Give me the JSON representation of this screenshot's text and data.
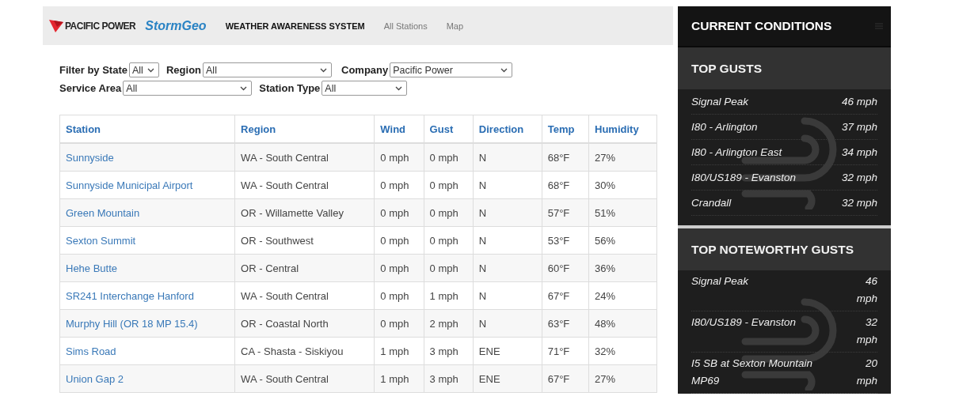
{
  "header": {
    "brand": "PACIFIC POWER",
    "partner": "StormGeo",
    "title": "WEATHER AWARENESS SYSTEM",
    "nav": [
      {
        "label": "All Stations"
      },
      {
        "label": "Map"
      }
    ]
  },
  "filter_rows": [
    [
      {
        "label": "Filter by State",
        "value": "All"
      },
      {
        "label": "Region",
        "value": "All"
      },
      {
        "label": "Company",
        "value": "Pacific Power"
      }
    ],
    [
      {
        "label": "Service Area",
        "value": "All"
      },
      {
        "label": "Station Type",
        "value": "All"
      }
    ]
  ],
  "table": {
    "columns": [
      "Station",
      "Region",
      "Wind",
      "Gust",
      "Direction",
      "Temp",
      "Humidity"
    ],
    "rows": [
      [
        "Sunnyside",
        "WA - South Central",
        "0 mph",
        "0 mph",
        "N",
        "68°F",
        "27%"
      ],
      [
        "Sunnyside Municipal Airport",
        "WA - South Central",
        "0 mph",
        "0 mph",
        "N",
        "68°F",
        "30%"
      ],
      [
        "Green Mountain",
        "OR - Willamette Valley",
        "0 mph",
        "0 mph",
        "N",
        "57°F",
        "51%"
      ],
      [
        "Sexton Summit",
        "OR - Southwest",
        "0 mph",
        "0 mph",
        "N",
        "53°F",
        "56%"
      ],
      [
        "Hehe Butte",
        "OR - Central",
        "0 mph",
        "0 mph",
        "N",
        "60°F",
        "36%"
      ],
      [
        "SR241 Interchange Hanford",
        "WA - South Central",
        "0 mph",
        "1 mph",
        "N",
        "67°F",
        "24%"
      ],
      [
        "Murphy Hill (OR 18 MP 15.4)",
        "OR - Coastal North",
        "0 mph",
        "2 mph",
        "N",
        "63°F",
        "48%"
      ],
      [
        "Sims Road",
        "CA - Shasta - Siskiyou",
        "1 mph",
        "3 mph",
        "ENE",
        "71°F",
        "32%"
      ],
      [
        "Union Gap 2",
        "WA - South Central",
        "1 mph",
        "3 mph",
        "ENE",
        "67°F",
        "27%"
      ]
    ]
  },
  "sidebar": {
    "title": "CURRENT CONDITIONS",
    "panels": [
      {
        "title": "TOP GUSTS",
        "items": [
          {
            "name": "Signal Peak",
            "value": "46 mph"
          },
          {
            "name": "I80 - Arlington",
            "value": "37 mph"
          },
          {
            "name": "I80 - Arlington East",
            "value": "34 mph"
          },
          {
            "name": "I80/US189 - Evanston",
            "value": "32 mph"
          },
          {
            "name": "Crandall",
            "value": "32 mph"
          }
        ]
      },
      {
        "title": "TOP NOTEWORTHY GUSTS",
        "items": [
          {
            "name": "Signal Peak",
            "value": "46 mph"
          },
          {
            "name": "I80/US189 - Evanston",
            "value": "32 mph"
          },
          {
            "name": "I5 SB at Sexton Mountain MP69",
            "value": "20 mph"
          }
        ]
      }
    ]
  }
}
